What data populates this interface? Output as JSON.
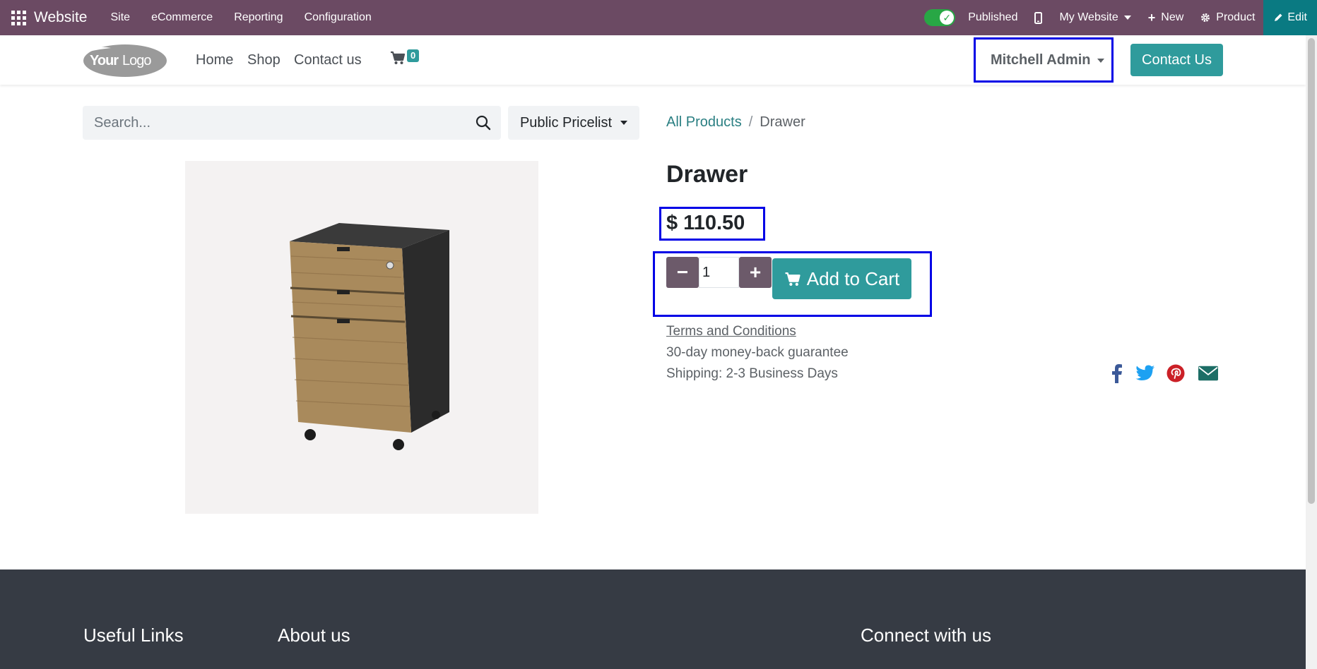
{
  "admin_bar": {
    "app_name": "Website",
    "menu": [
      "Site",
      "eCommerce",
      "Reporting",
      "Configuration"
    ],
    "published_label": "Published",
    "website_label": "My Website",
    "new_label": "New",
    "product_label": "Product",
    "edit_label": "Edit"
  },
  "header": {
    "logo_text_bold": "Your",
    "logo_text": "Logo",
    "nav": [
      "Home",
      "Shop",
      "Contact us"
    ],
    "cart_count": "0",
    "user_name": "Mitchell Admin",
    "contact_button": "Contact Us"
  },
  "search": {
    "placeholder": "Search..."
  },
  "pricelist": {
    "label": "Public Pricelist"
  },
  "breadcrumb": {
    "parent": "All Products",
    "separator": "/",
    "current": "Drawer"
  },
  "product": {
    "title": "Drawer",
    "price": "$ 110.50",
    "quantity": "1",
    "add_to_cart": "Add to Cart",
    "terms": "Terms and Conditions",
    "guarantee": "30-day money-back guarantee",
    "shipping": "Shipping: 2-3 Business Days"
  },
  "footer": {
    "col1_title": "Useful Links",
    "col2_title": "About us",
    "col3_title": "Connect with us"
  },
  "colors": {
    "admin_bar": "#6b4a63",
    "primary": "#2f9b9c",
    "highlight_border": "#0000e6",
    "footer_bg": "#363b44"
  }
}
